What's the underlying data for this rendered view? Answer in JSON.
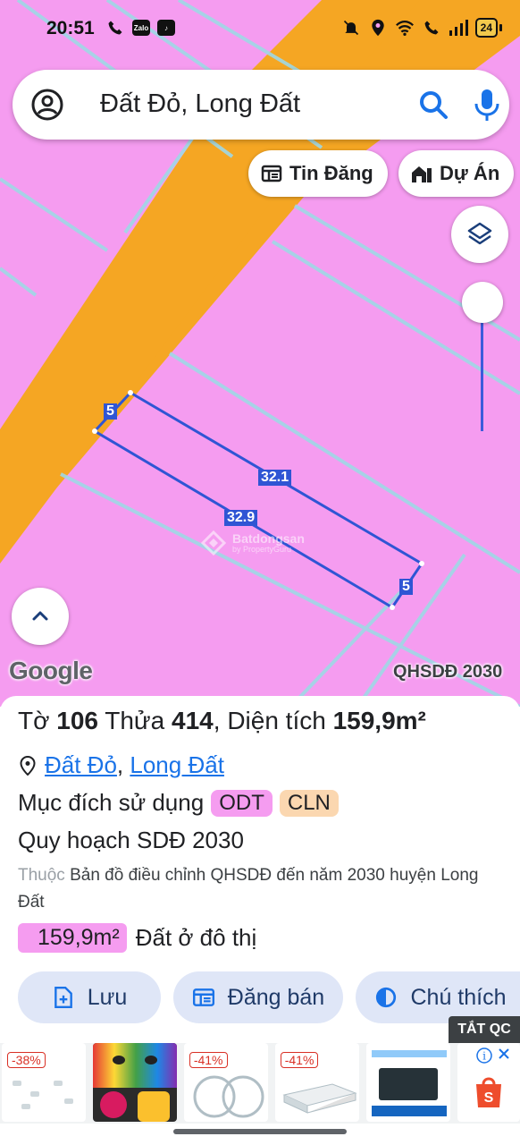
{
  "status_bar": {
    "time": "20:51",
    "left_icons": [
      "phone-call-icon",
      "zalo-icon",
      "tiktok-icon"
    ],
    "right_icons": [
      "mute-icon",
      "location-icon",
      "wifi-icon",
      "wifi-call-icon",
      "signal-icon"
    ],
    "battery": "24"
  },
  "search": {
    "query": "Đất Đỏ, Long Đất"
  },
  "chips": {
    "listings_label": "Tin Đăng",
    "projects_label": "Dự Án"
  },
  "map": {
    "lot_edges": {
      "top_short": "5",
      "top_long": "32.1",
      "bottom_long": "32.9",
      "bottom_short": "5"
    },
    "attribution": "Google",
    "layer_label": "QHSDĐ 2030",
    "watermark": "Batdongsan",
    "watermark_sub": "by PropertyGuru",
    "colors": {
      "residential": "#f59cf0",
      "perennial": "#f5a623",
      "road_line": "#9fd8e6",
      "lot_outline": "#2f55d4"
    }
  },
  "parcel": {
    "sheet_label": "Tờ",
    "sheet_no": "106",
    "lot_label": "Thửa",
    "lot_no": "414",
    "area_label": "Diện tích",
    "area": "159,9m²",
    "location_district": "Đất Đỏ",
    "location_sep": ",",
    "location_province": "Long Đất",
    "purpose_label": "Mục đích sử dụng",
    "purposes": [
      "ODT",
      "CLN"
    ],
    "plan_title": "Quy hoạch SDĐ 2030",
    "plan_prefix": "Thuộc",
    "plan_desc": "Bản đồ điều chỉnh QHSDĐ đến năm 2030 huyện Long Đất",
    "zone_area": "159,9m²",
    "zone_label": "Đất ở đô thị"
  },
  "actions": {
    "save": "Lưu",
    "post_sale": "Đăng bán",
    "legend": "Chú thích"
  },
  "ads": {
    "close_label": "TẮT QC",
    "discounts": [
      "-38%",
      "-41%",
      "-41%"
    ]
  }
}
